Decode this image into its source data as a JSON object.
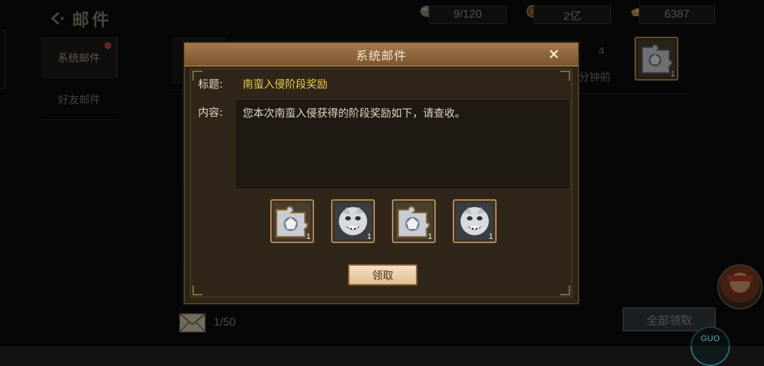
{
  "header": {
    "title": "邮件"
  },
  "resources": [
    {
      "icon": "stone-icon",
      "value": "9/120"
    },
    {
      "icon": "coin-icon",
      "value": "2亿"
    },
    {
      "icon": "gold-ingot-icon",
      "value": "6387"
    }
  ],
  "tabs": [
    {
      "label": "系统邮件",
      "active": true,
      "has_dot": true
    },
    {
      "label": "好友邮件",
      "active": false,
      "has_dot": false
    }
  ],
  "mail_row": {
    "count": "4",
    "time": "分钟前",
    "item_count": "1"
  },
  "footer": {
    "mail_count": "1/50",
    "claim_all_label": "全部领取"
  },
  "dialog": {
    "title": "系统邮件",
    "close_icon": "×",
    "subject_label": "标题:",
    "subject_value": "南蛮入侵阶段奖励",
    "content_label": "内容:",
    "content_text": "您本次南蛮入侵获得的阶段奖励如下，请查收。",
    "rewards": [
      {
        "icon": "puzzle-fragment-icon",
        "count": "1"
      },
      {
        "icon": "silver-beast-head-icon",
        "count": "1"
      },
      {
        "icon": "puzzle-fragment-icon",
        "count": "1"
      },
      {
        "icon": "silver-beast-head-icon",
        "count": "1"
      }
    ],
    "claim_label": "领取"
  }
}
